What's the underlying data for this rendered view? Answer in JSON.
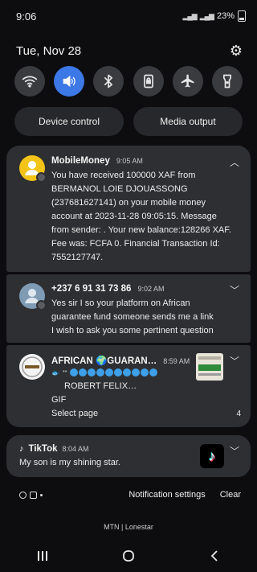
{
  "status": {
    "time": "9:06",
    "battery": "23%"
  },
  "header": {
    "date": "Tue, Nov 28"
  },
  "quick_toggles": [
    {
      "icon": "wifi-icon",
      "active": false
    },
    {
      "icon": "sound-icon",
      "active": true
    },
    {
      "icon": "bluetooth-icon",
      "active": false
    },
    {
      "icon": "rotation-lock-icon",
      "active": false
    },
    {
      "icon": "airplane-icon",
      "active": false
    },
    {
      "icon": "flashlight-icon",
      "active": false
    }
  ],
  "pills": {
    "device_control": "Device control",
    "media_output": "Media output"
  },
  "notifications": {
    "mobilemoney": {
      "app": "MobileMoney",
      "time": "9:05 AM",
      "body_lines": [
        "You have received 100000 XAF from",
        "BERMANOL LOIE DJOUASSONG",
        "(237681627141) on your mobile money",
        "account at 2023-11-28 09:05:15. Message",
        "from sender: . Your new balance:128266 XAF.",
        "Fee was: FCFA 0. Financial Transaction Id:",
        "7552127747."
      ]
    },
    "sms": {
      "sender": "+237 6 91 31 73 86",
      "time": "9:02 AM",
      "body_lines": [
        "Yes sir I so your platform on African",
        "guarantee fund someone sends me a link",
        "I wish to ask you some pertinent question"
      ]
    },
    "group": {
      "title": "AFRICAN 🌍GUARAN…",
      "time": "8:59 AM",
      "line1": "ROBERT FELIX…",
      "line2": "GIF",
      "action": "Select page",
      "count": "4"
    },
    "tiktok": {
      "app": "TikTok",
      "time": "8:04 AM",
      "body": "My son is my shining star."
    }
  },
  "footer": {
    "settings": "Notification settings",
    "clear": "Clear"
  },
  "carrier": "MTN | Lonestar",
  "colors": {
    "accent": "#3c78e6",
    "card": "#2e2f33",
    "background": "#0d0d0f",
    "mobilemoney": "#f2c418"
  }
}
